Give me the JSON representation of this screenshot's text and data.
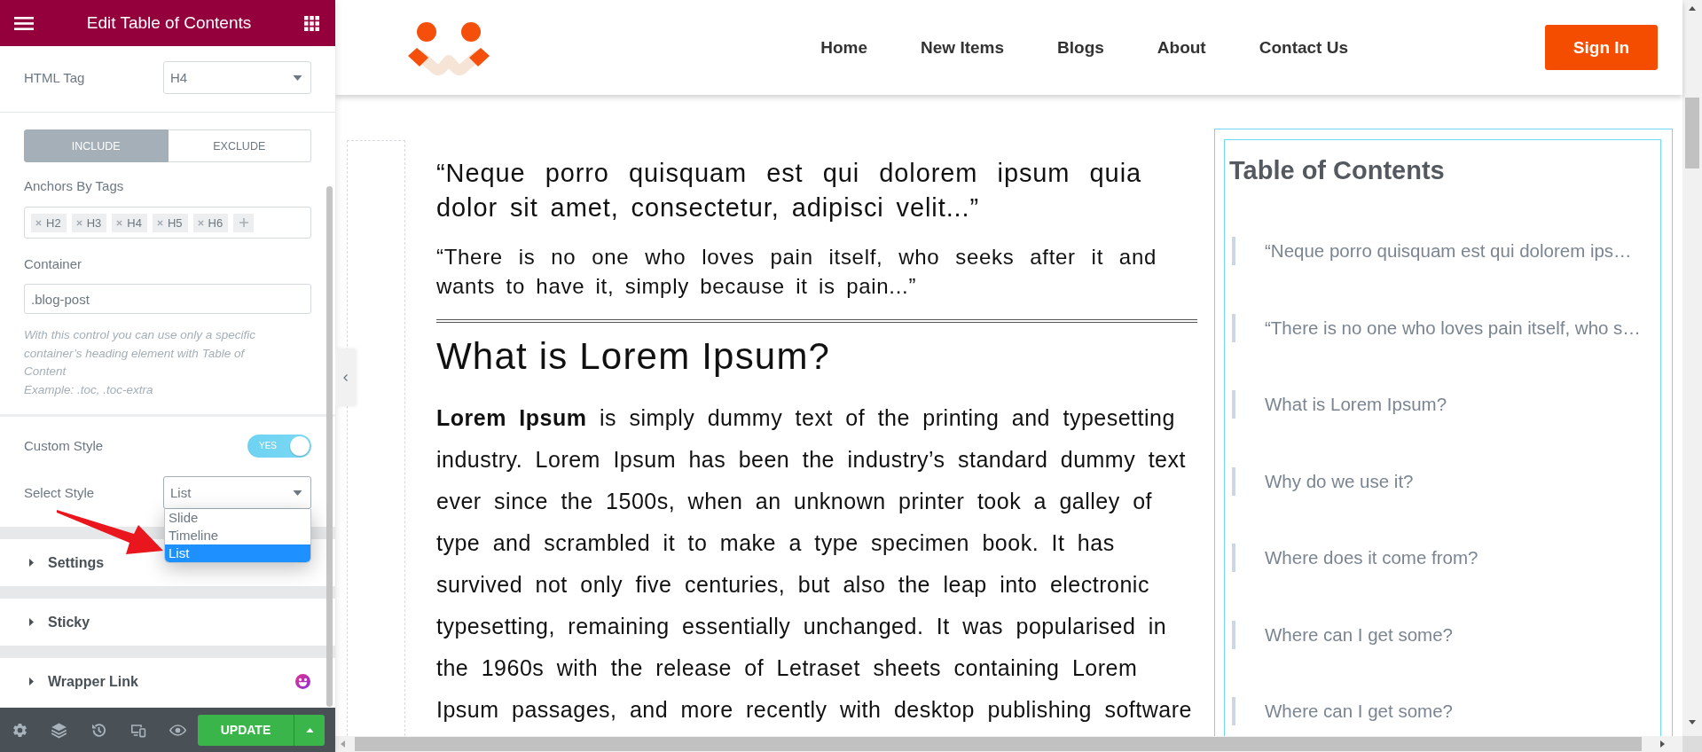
{
  "editor": {
    "title": "Edit Table of Contents",
    "html_tag": {
      "label": "HTML Tag",
      "value": "H4"
    },
    "anchor_tabs": [
      {
        "label": "INCLUDE",
        "selected": true
      },
      {
        "label": "EXCLUDE",
        "selected": false
      }
    ],
    "anchors_by_tags": {
      "label": "Anchors By Tags",
      "tags": [
        "H2",
        "H3",
        "H4",
        "H5",
        "H6"
      ]
    },
    "container": {
      "label": "Container",
      "value": ".blog-post",
      "help": "With this control you can use only a specific container’s heading element with Table of Content",
      "example": "Example: .toc, .toc-extra"
    },
    "custom_style": {
      "label": "Custom Style",
      "on": true,
      "on_label": "YES"
    },
    "select_style": {
      "label": "Select Style",
      "value": "List",
      "expanded": true,
      "options": [
        {
          "label": "Slide",
          "selected": false
        },
        {
          "label": "Timeline",
          "selected": false
        },
        {
          "label": "List",
          "selected": true
        }
      ]
    },
    "sections": [
      {
        "label": "Settings",
        "badge": false
      },
      {
        "label": "Sticky",
        "badge": false
      },
      {
        "label": "Wrapper Link",
        "badge": true
      }
    ],
    "footer": {
      "update_label": "UPDATE"
    }
  },
  "site": {
    "nav": [
      "Home",
      "New Items",
      "Blogs",
      "About",
      "Contact Us"
    ],
    "sign_in": "Sign In"
  },
  "article": {
    "lead_quote": "“Neque porro quisquam est qui dolorem ipsum quia dolor sit amet, consectetur, adipisci velit...”",
    "sub_quote": "“There is no one who loves pain itself, who seeks after it and wants to have it, simply because it is pain...”",
    "heading": "What is Lorem Ipsum?",
    "paragraph": "**Lorem Ipsum** is simply dummy text of the printing and typesetting industry. Lorem Ipsum has been the industry’s standard dummy text ever since the 1500s, when an unknown printer took a galley of type and scrambled it to make a type specimen book. It has survived not only five centuries, but also the leap into electronic typesetting, remaining essentially unchanged. It was popularised in the 1960s with the release of Letraset sheets containing Lorem Ipsum passages, and more recently with desktop publishing software"
  },
  "toc": {
    "title": "Table of Contents",
    "items": [
      "“Neque porro quisquam est qui dolorem ips…",
      "“There is no one who loves pain itself, who s…",
      "What is Lorem Ipsum?",
      "Why do we use it?",
      "Where does it come from?",
      "Where can I get some?",
      "Where can I get some?"
    ]
  }
}
